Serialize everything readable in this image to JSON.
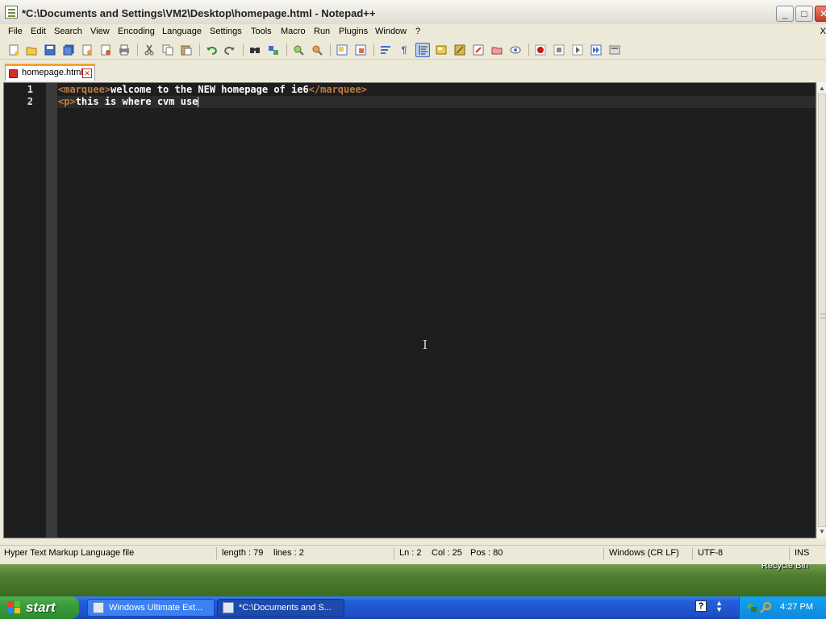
{
  "window": {
    "title": "*C:\\Documents and Settings\\VM2\\Desktop\\homepage.html - Notepad++",
    "minimize_label": "_",
    "maximize_label": "□",
    "close_label": "✕"
  },
  "menu": {
    "items": [
      "File",
      "Edit",
      "Search",
      "View",
      "Encoding",
      "Language",
      "Settings",
      "Tools",
      "Macro",
      "Run",
      "Plugins",
      "Window",
      "?"
    ],
    "doc_close": "X"
  },
  "toolbar": {
    "buttons": [
      "new-file-icon",
      "open-file-icon",
      "save-icon",
      "save-all-icon",
      "close-icon",
      "close-all-icon",
      "print-icon",
      "cut-icon",
      "copy-icon",
      "paste-icon",
      "undo-icon",
      "redo-icon",
      "find-icon",
      "replace-icon",
      "zoom-in-icon",
      "zoom-out-icon",
      "sync-vertical-icon",
      "sync-horizontal-icon",
      "word-wrap-icon",
      "show-all-characters-icon",
      "indent-guide-icon",
      "user-defined-language-icon",
      "document-map-icon",
      "function-list-icon",
      "folder-as-workspace-icon",
      "monitoring-icon",
      "record-macro-icon",
      "stop-recording-icon",
      "play-macro-icon",
      "run-macro-multiple-icon",
      "save-macro-icon"
    ]
  },
  "tab": {
    "label": "homepage.html",
    "close": "✕"
  },
  "editor": {
    "lines": [
      {
        "number": "1",
        "open_tag": "<marquee>",
        "text": "welcome to the NEW homepage of ie6",
        "close_tag": "</marquee>"
      },
      {
        "number": "2",
        "open_tag": "<p>",
        "text": "this is where cvm use",
        "close_tag": ""
      }
    ]
  },
  "statusbar": {
    "file_type": "Hyper Text Markup Language file",
    "length": "length : 79",
    "lines": "lines : 2",
    "ln": "Ln : 2",
    "col": "Col : 25",
    "pos": "Pos : 80",
    "eol": "Windows (CR LF)",
    "encoding": "UTF-8",
    "mode": "INS"
  },
  "desktop": {
    "recycle_bin_label": "Recycle Bin"
  },
  "taskbar": {
    "start_label": "start",
    "tasks": [
      {
        "label": "Windows Ultimate Ext...",
        "active": false
      },
      {
        "label": "*C:\\Documents and S...",
        "active": true
      }
    ],
    "help_label": "?",
    "clock": "4:27 PM"
  },
  "colors": {
    "editor_background": "#1e1e1e",
    "tag_color": "#c27c3b",
    "text_color": "#ffffff",
    "tab_accent": "#f3a433",
    "taskbar_blue": "#245edb",
    "start_green": "#3a9c3a"
  }
}
